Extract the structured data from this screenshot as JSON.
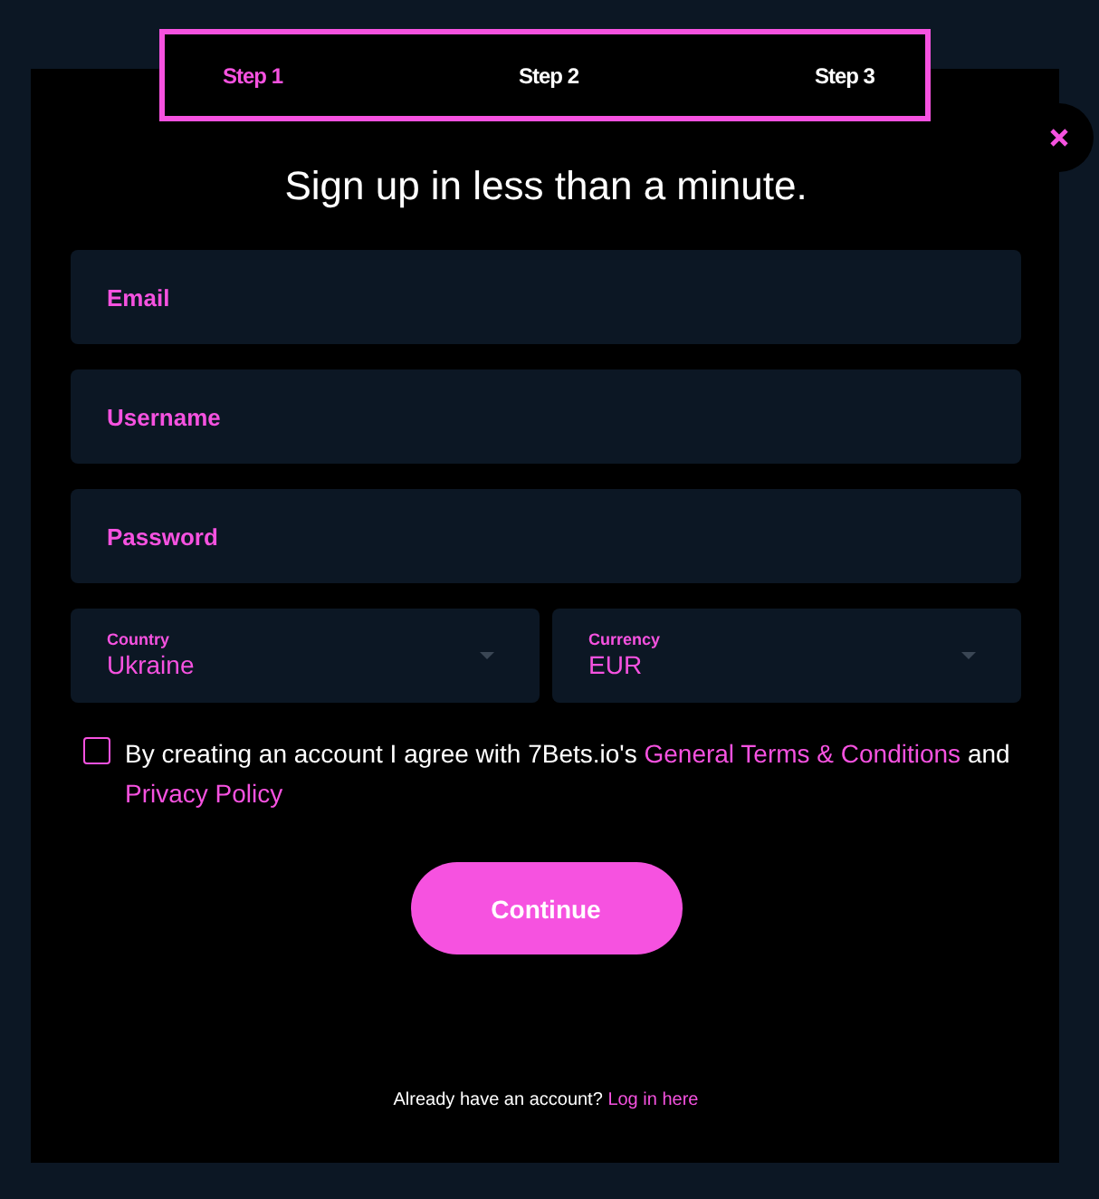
{
  "steps": [
    {
      "label": "Step 1",
      "selected": true
    },
    {
      "label": "Step 2",
      "selected": false
    },
    {
      "label": "Step 3",
      "selected": false
    }
  ],
  "title": "Sign up in less than a minute.",
  "fields": [
    {
      "placeholder": "Email"
    },
    {
      "placeholder": "Username"
    },
    {
      "placeholder": "Password"
    }
  ],
  "selects": [
    {
      "label": "Country",
      "value": "Ukraine"
    },
    {
      "label": "Currency",
      "value": "EUR"
    }
  ],
  "agreement": {
    "checked": false,
    "text_before": "By creating an account I agree with 7Bets.io's",
    "terms_link": "General Terms & Conditions",
    "text_middle": "and",
    "privacy_link": "Privacy Policy"
  },
  "continue_button": "Continue",
  "footer": {
    "text": "Already have an account?",
    "link": "Log in here"
  }
}
